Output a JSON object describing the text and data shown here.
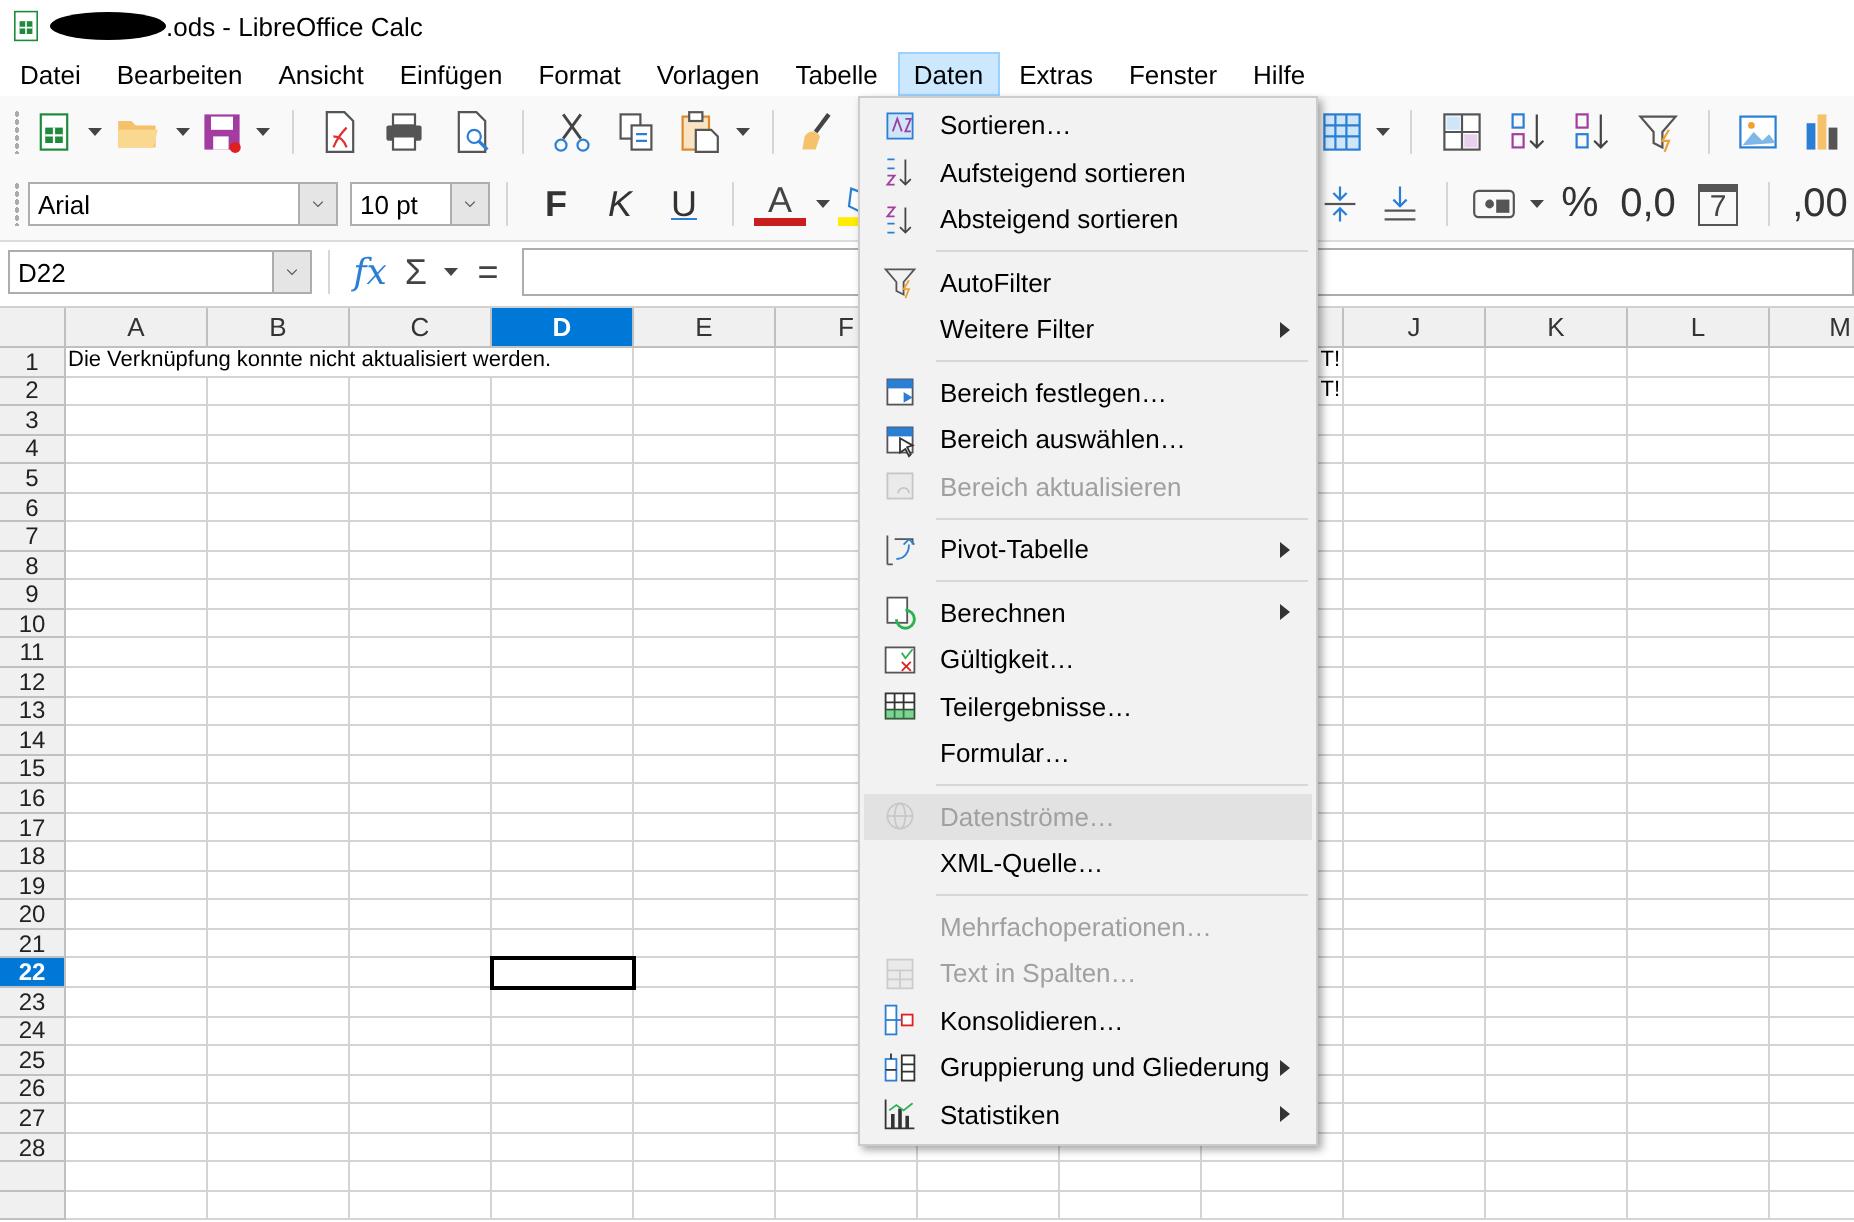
{
  "window": {
    "title": ".ods - LibreOffice Calc"
  },
  "menubar": [
    {
      "label": "Datei",
      "selected": false
    },
    {
      "label": "Bearbeiten",
      "selected": false
    },
    {
      "label": "Ansicht",
      "selected": false
    },
    {
      "label": "Einfügen",
      "selected": false
    },
    {
      "label": "Format",
      "selected": false
    },
    {
      "label": "Vorlagen",
      "selected": false
    },
    {
      "label": "Tabelle",
      "selected": false
    },
    {
      "label": "Daten",
      "selected": true
    },
    {
      "label": "Extras",
      "selected": false
    },
    {
      "label": "Fenster",
      "selected": false
    },
    {
      "label": "Hilfe",
      "selected": false
    }
  ],
  "formatting_toolbar": {
    "font_name": "Arial",
    "font_size": "10 pt",
    "bold": "F",
    "italic": "K",
    "underline": "U",
    "font_color": "A",
    "percent": "%",
    "number_format": "0,0",
    "date_format": "7",
    "decimal_places": ",00"
  },
  "formula_bar": {
    "name_box": "D22",
    "function_wizard": "fx",
    "sum": "Σ",
    "equals": "="
  },
  "sheet": {
    "columns": [
      {
        "label": "A",
        "selected": false
      },
      {
        "label": "B",
        "selected": false
      },
      {
        "label": "C",
        "selected": false
      },
      {
        "label": "D",
        "selected": true
      },
      {
        "label": "E",
        "selected": false
      },
      {
        "label": "F",
        "selected": false
      },
      {
        "label": "J",
        "selected": false
      },
      {
        "label": "K",
        "selected": false
      },
      {
        "label": "L",
        "selected": false
      },
      {
        "label": "M",
        "selected": false
      }
    ],
    "rows": [
      {
        "label": "1",
        "selected": false,
        "cells": {
          "A": "Die Verknüpfung konnte nicht aktualisiert werden.",
          "column_9": "T!"
        }
      },
      {
        "label": "2",
        "selected": false,
        "cells": {
          "column_9": "T!"
        }
      },
      {
        "label": "3",
        "selected": false
      },
      {
        "label": "4",
        "selected": false
      },
      {
        "label": "5",
        "selected": false
      },
      {
        "label": "6",
        "selected": false
      },
      {
        "label": "7",
        "selected": false
      },
      {
        "label": "8",
        "selected": false
      },
      {
        "label": "9",
        "selected": false
      },
      {
        "label": "10",
        "selected": false
      },
      {
        "label": "11",
        "selected": false
      },
      {
        "label": "12",
        "selected": false
      },
      {
        "label": "13",
        "selected": false
      },
      {
        "label": "14",
        "selected": false
      },
      {
        "label": "15",
        "selected": false
      },
      {
        "label": "16",
        "selected": false
      },
      {
        "label": "17",
        "selected": false
      },
      {
        "label": "18",
        "selected": false
      },
      {
        "label": "19",
        "selected": false
      },
      {
        "label": "20",
        "selected": false
      },
      {
        "label": "21",
        "selected": false
      },
      {
        "label": "22",
        "selected": true
      },
      {
        "label": "23",
        "selected": false
      },
      {
        "label": "24",
        "selected": false
      },
      {
        "label": "25",
        "selected": false
      },
      {
        "label": "26",
        "selected": false
      },
      {
        "label": "27",
        "selected": false
      },
      {
        "label": "28",
        "selected": false
      }
    ]
  },
  "daten_menu": {
    "items": [
      {
        "kind": "item",
        "label": "Sortieren…",
        "disabled": false,
        "highlighted": false,
        "submenu": false
      },
      {
        "kind": "item",
        "label": "Aufsteigend sortieren",
        "disabled": false,
        "highlighted": false,
        "submenu": false
      },
      {
        "kind": "item",
        "label": "Absteigend sortieren",
        "disabled": false,
        "highlighted": false,
        "submenu": false
      },
      {
        "kind": "separator"
      },
      {
        "kind": "item",
        "label": "AutoFilter",
        "disabled": false,
        "highlighted": false,
        "submenu": false
      },
      {
        "kind": "item",
        "label": "Weitere Filter",
        "disabled": false,
        "highlighted": false,
        "submenu": true
      },
      {
        "kind": "separator"
      },
      {
        "kind": "item",
        "label": "Bereich festlegen…",
        "disabled": false,
        "highlighted": false,
        "submenu": false
      },
      {
        "kind": "item",
        "label": "Bereich auswählen…",
        "disabled": false,
        "highlighted": false,
        "submenu": false
      },
      {
        "kind": "item",
        "label": "Bereich aktualisieren",
        "disabled": true,
        "highlighted": false,
        "submenu": false
      },
      {
        "kind": "separator"
      },
      {
        "kind": "item",
        "label": "Pivot-Tabelle",
        "disabled": false,
        "highlighted": false,
        "submenu": true
      },
      {
        "kind": "separator"
      },
      {
        "kind": "item",
        "label": "Berechnen",
        "disabled": false,
        "highlighted": false,
        "submenu": true
      },
      {
        "kind": "item",
        "label": "Gültigkeit…",
        "disabled": false,
        "highlighted": false,
        "submenu": false
      },
      {
        "kind": "item",
        "label": "Teilergebnisse…",
        "disabled": false,
        "highlighted": false,
        "submenu": false
      },
      {
        "kind": "item",
        "label": "Formular…",
        "disabled": false,
        "highlighted": false,
        "submenu": false
      },
      {
        "kind": "separator"
      },
      {
        "kind": "item",
        "label": "Datenströme…",
        "disabled": true,
        "highlighted": true,
        "submenu": false
      },
      {
        "kind": "item",
        "label": "XML-Quelle…",
        "disabled": false,
        "highlighted": false,
        "submenu": false
      },
      {
        "kind": "separator"
      },
      {
        "kind": "item",
        "label": "Mehrfachoperationen…",
        "disabled": true,
        "highlighted": false,
        "submenu": false
      },
      {
        "kind": "item",
        "label": "Text in Spalten…",
        "disabled": true,
        "highlighted": false,
        "submenu": false
      },
      {
        "kind": "item",
        "label": "Konsolidieren…",
        "disabled": false,
        "highlighted": false,
        "submenu": false
      },
      {
        "kind": "item",
        "label": "Gruppierung und Gliederung",
        "disabled": false,
        "highlighted": false,
        "submenu": true
      },
      {
        "kind": "item",
        "label": "Statistiken",
        "disabled": false,
        "highlighted": false,
        "submenu": true
      }
    ]
  }
}
